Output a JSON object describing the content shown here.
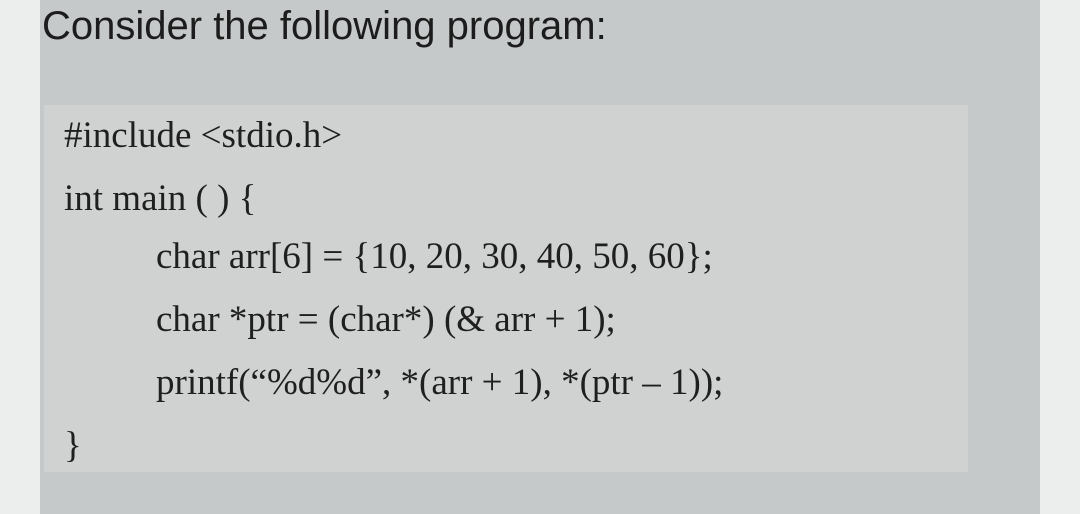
{
  "question": {
    "text": "Consider the following program:"
  },
  "code": {
    "lines": [
      "#include <stdio.h>",
      "int main ( ) {",
      "char arr[6] = {10, 20, 30, 40, 50, 60};",
      "char *ptr = (char*) (& arr + 1);",
      "printf(“%d%d”, *(arr + 1), *(ptr – 1));",
      "}"
    ]
  },
  "colors": {
    "page_background": "#eceeee",
    "panel_background": "#c5c9c9",
    "code_background": "#d0d1d1",
    "text": "#1f1f1f"
  }
}
